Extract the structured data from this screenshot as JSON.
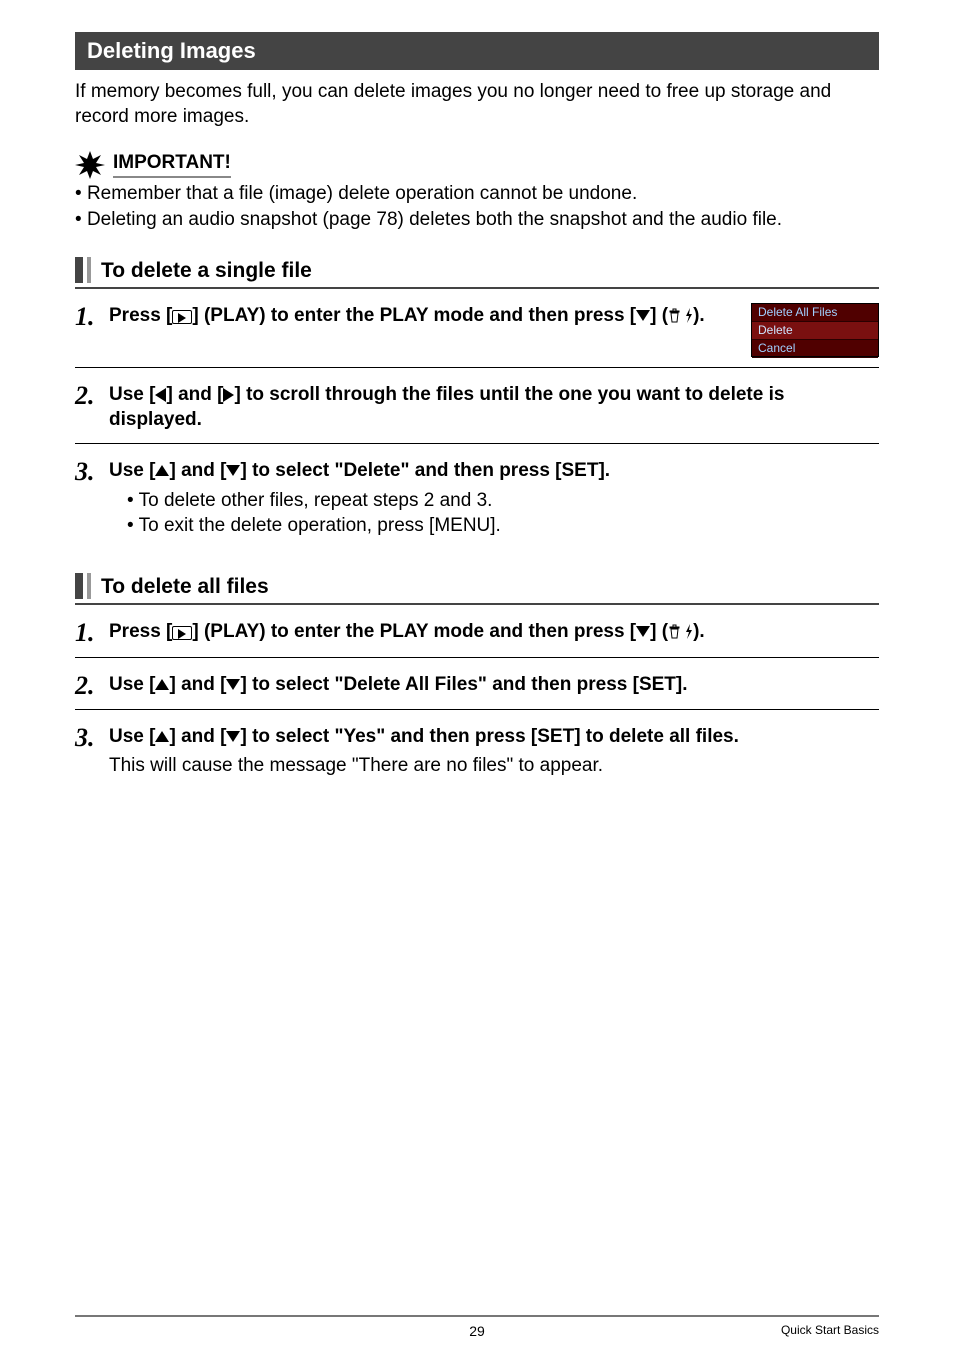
{
  "header": {
    "title": "Deleting Images"
  },
  "intro": "If memory becomes full, you can delete images you no longer need to free up storage and record more images.",
  "important": {
    "label": "IMPORTANT!",
    "items": [
      "Remember that a file (image) delete operation cannot be undone.",
      "Deleting an audio snapshot (page 78) deletes both the snapshot and the audio file."
    ]
  },
  "single": {
    "title": "To delete a single file",
    "step1_a": "Press [",
    "step1_b": "] (PLAY) to enter the PLAY mode and then press [",
    "step1_c": "] (",
    "step1_d": ").",
    "menu": {
      "opt1": "Delete All Files",
      "opt2": "Delete",
      "opt3": "Cancel"
    },
    "step2_a": "Use [",
    "step2_b": "] and [",
    "step2_c": "] to scroll through the files until the one you want to delete is displayed.",
    "step3_a": "Use [",
    "step3_b": "] and [",
    "step3_c": "] to select \"Delete\" and then press [SET].",
    "step3_notes": [
      "To delete other files, repeat steps 2 and 3.",
      "To exit the delete operation, press [MENU]."
    ]
  },
  "all": {
    "title": "To delete all files",
    "step1_a": "Press [",
    "step1_b": "] (PLAY) to enter the PLAY mode and then press [",
    "step1_c": "] (",
    "step1_d": ").",
    "step2_a": "Use [",
    "step2_b": "] and [",
    "step2_c": "] to select \"Delete All Files\" and then press [SET].",
    "step3_a": "Use [",
    "step3_b": "] and [",
    "step3_c": "] to select \"Yes\" and then press [SET] to delete all files.",
    "step3_note": "This will cause the message \"There are no files\" to appear."
  },
  "footer": {
    "page": "29",
    "section": "Quick Start Basics"
  }
}
